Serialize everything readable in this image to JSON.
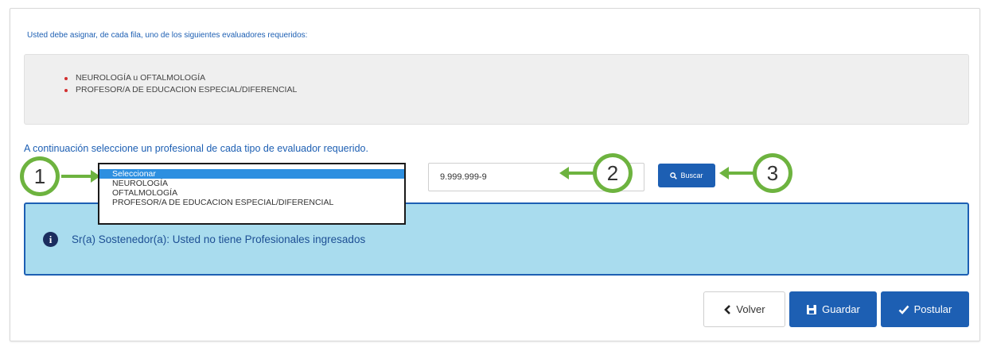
{
  "intro_text": "Usted debe asignar, de cada fila, uno de los siguientes evaluadores requeridos:",
  "required_evaluators": [
    "NEUROLOGÍA u OFTALMOLOGÍA",
    "PROFESOR/A DE EDUCACION ESPECIAL/DIFERENCIAL"
  ],
  "instruction": "A continuación seleccione un profesional de cada tipo de evaluador requerido.",
  "dropdown": {
    "selected": "Seleccionar",
    "options": [
      "NEUROLOGÍA",
      "OFTALMOLOGÍA",
      "PROFESOR/A DE EDUCACION ESPECIAL/DIFERENCIAL"
    ]
  },
  "rut_input": {
    "value": "9.999.999-9"
  },
  "search_button": {
    "label": "Buscar",
    "icon": "search-icon"
  },
  "callouts": [
    "1",
    "2",
    "3"
  ],
  "alert": {
    "icon": "info-icon",
    "text": "Sr(a) Sostenedor(a): Usted no tiene Profesionales ingresados"
  },
  "footer_buttons": {
    "back": {
      "label": "Volver",
      "icon": "chevron-left-icon"
    },
    "save": {
      "label": "Guardar",
      "icon": "save-icon"
    },
    "submit": {
      "label": "Postular",
      "icon": "check-icon"
    }
  },
  "colors": {
    "primary": "#1d5fb3",
    "alert_bg": "#a9dcee",
    "callout": "#6db33f",
    "bullet": "#d22f2f"
  }
}
